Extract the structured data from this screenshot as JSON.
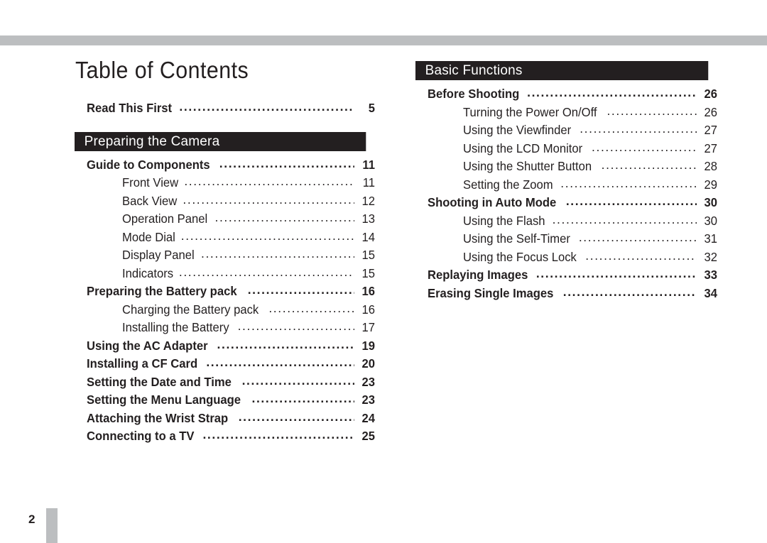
{
  "document": {
    "title": "Table of Contents",
    "page_number": "2"
  },
  "left_column": {
    "standalone_entries": [
      {
        "label": "Read This First",
        "page": "5",
        "level": 1
      }
    ],
    "sections": [
      {
        "heading": "Preparing the Camera",
        "entries": [
          {
            "label": "Guide to Components",
            "page": "11",
            "level": 1
          },
          {
            "label": "Front View",
            "page": "11",
            "level": 2
          },
          {
            "label": "Back View",
            "page": "12",
            "level": 2
          },
          {
            "label": "Operation Panel",
            "page": "13",
            "level": 2
          },
          {
            "label": "Mode Dial",
            "page": "14",
            "level": 2
          },
          {
            "label": "Display Panel",
            "page": "15",
            "level": 2
          },
          {
            "label": "Indicators",
            "page": "15",
            "level": 2
          },
          {
            "label": "Preparing the Battery pack",
            "page": "16",
            "level": 1
          },
          {
            "label": "Charging the Battery pack",
            "page": "16",
            "level": 2
          },
          {
            "label": "Installing the Battery",
            "page": "17",
            "level": 2
          },
          {
            "label": "Using the AC Adapter",
            "page": "19",
            "level": 1
          },
          {
            "label": "Installing a CF Card",
            "page": "20",
            "level": 1
          },
          {
            "label": "Setting the Date and Time",
            "page": "23",
            "level": 1
          },
          {
            "label": "Setting the Menu Language",
            "page": "23",
            "level": 1
          },
          {
            "label": "Attaching the Wrist Strap",
            "page": "24",
            "level": 1
          },
          {
            "label": "Connecting to a TV",
            "page": "25",
            "level": 1
          }
        ]
      }
    ]
  },
  "right_column": {
    "sections": [
      {
        "heading": "Basic Functions",
        "entries": [
          {
            "label": "Before Shooting",
            "page": "26",
            "level": 1
          },
          {
            "label": "Turning the Power On/Off",
            "page": "26",
            "level": 2
          },
          {
            "label": "Using the Viewfinder",
            "page": "27",
            "level": 2
          },
          {
            "label": "Using the LCD Monitor",
            "page": "27",
            "level": 2
          },
          {
            "label": "Using the Shutter Button",
            "page": "28",
            "level": 2
          },
          {
            "label": "Setting the Zoom",
            "page": "29",
            "level": 2
          },
          {
            "label": "Shooting in Auto Mode",
            "page": "30",
            "level": 1
          },
          {
            "label": "Using the Flash",
            "page": "30",
            "level": 2
          },
          {
            "label": "Using the Self-Timer",
            "page": "31",
            "level": 2
          },
          {
            "label": "Using the Focus Lock",
            "page": "32",
            "level": 2
          },
          {
            "label": "Replaying Images",
            "page": "33",
            "level": 1
          },
          {
            "label": "Erasing Single Images",
            "page": "34",
            "level": 1
          }
        ]
      }
    ]
  },
  "colors": {
    "rule": "#bcbec0",
    "section_bar": "#231f20",
    "text": "#231f20"
  }
}
